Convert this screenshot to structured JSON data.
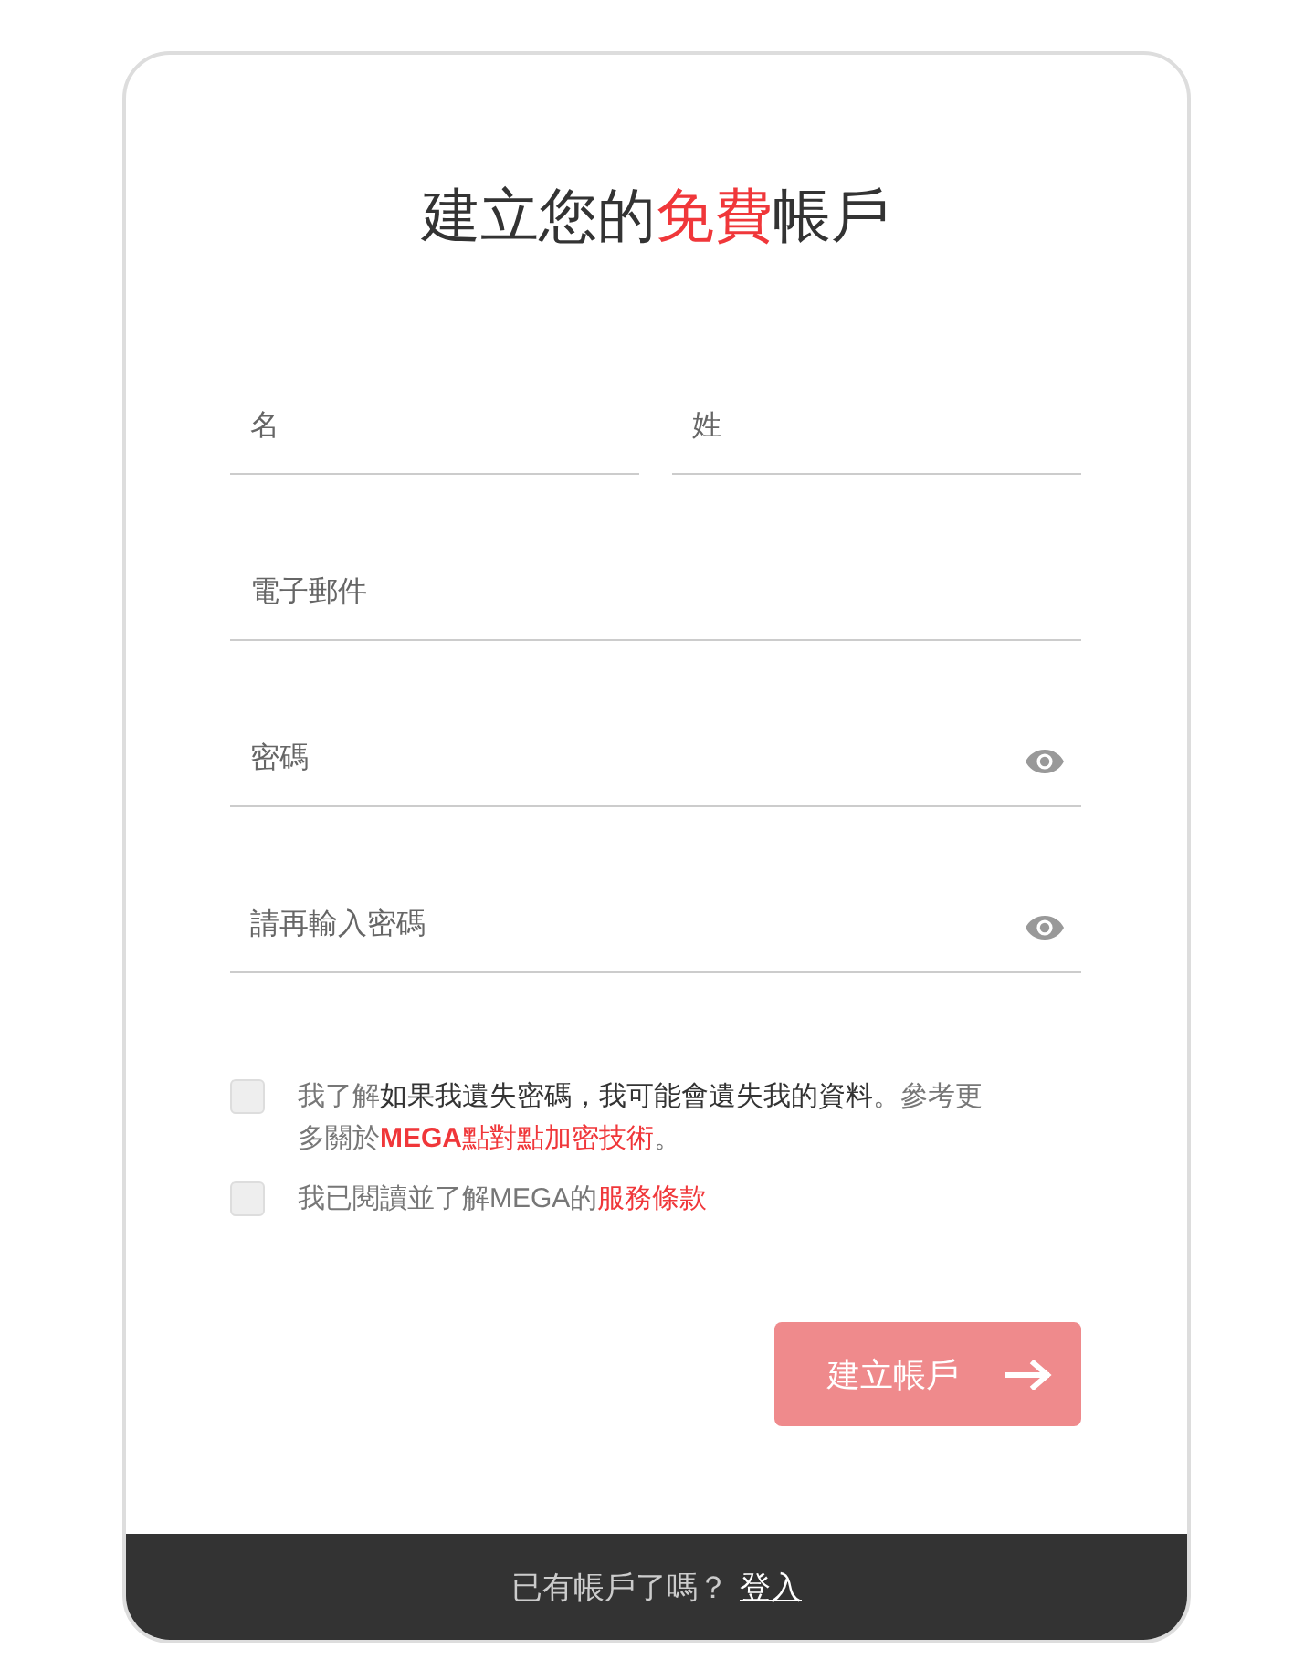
{
  "title": {
    "parts": [
      {
        "text": "建立您的",
        "accent": false
      },
      {
        "text": "免費",
        "accent": true
      },
      {
        "text": "帳戶",
        "accent": false
      }
    ]
  },
  "name_fields": [
    {
      "placeholder": "名"
    },
    {
      "placeholder": "姓"
    }
  ],
  "fields": [
    {
      "kind": "text",
      "placeholder": "電子郵件"
    },
    {
      "kind": "password",
      "placeholder": "密碼"
    },
    {
      "kind": "password",
      "placeholder": "請再輸入密碼"
    }
  ],
  "agreements": [
    {
      "checked": false,
      "parts": [
        {
          "kind": "text",
          "text": "我了解"
        },
        {
          "kind": "strong",
          "text": "如果我遺失密碼，我可能會遺失我的資料"
        },
        {
          "kind": "text",
          "text": "。參考更多關於"
        },
        {
          "kind": "link",
          "text": "**MEGA**點對點加密技術"
        },
        {
          "kind": "text",
          "text": "。"
        }
      ]
    },
    {
      "checked": false,
      "parts": [
        {
          "kind": "text",
          "text": "我已閱讀並了解MEGA的"
        },
        {
          "kind": "link",
          "text": "服務條款"
        }
      ]
    }
  ],
  "submit": {
    "label": "建立帳戶",
    "disabled": true
  },
  "footer": {
    "prompt": "已有帳戶了嗎？",
    "link": "登入"
  }
}
